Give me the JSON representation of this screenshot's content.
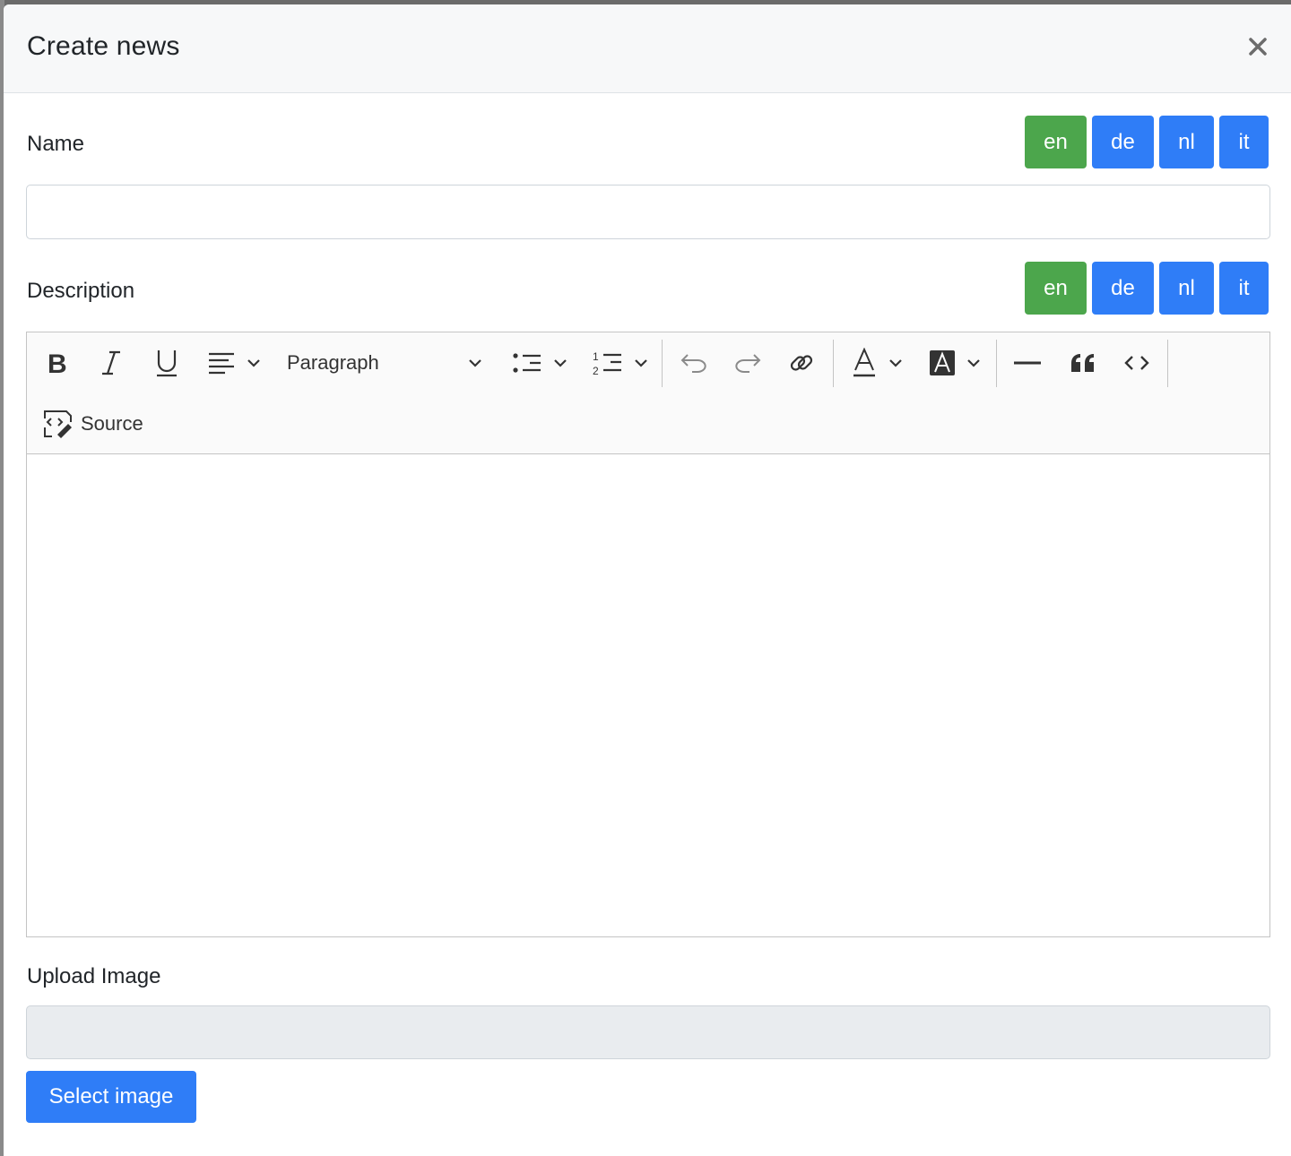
{
  "modal": {
    "title": "Create news",
    "close_icon": "close-icon"
  },
  "name_field": {
    "label": "Name",
    "value": "",
    "placeholder": ""
  },
  "description_field": {
    "label": "Description"
  },
  "languages": {
    "items": [
      {
        "code": "en",
        "active": true
      },
      {
        "code": "de",
        "active": false
      },
      {
        "code": "nl",
        "active": false
      },
      {
        "code": "it",
        "active": false
      }
    ],
    "active_color": "#4ca64c",
    "inactive_color": "#2f7df7"
  },
  "editor": {
    "toolbar": {
      "bold_icon": "bold-icon",
      "italic_icon": "italic-icon",
      "underline_icon": "underline-icon",
      "align_icon": "align-left-icon",
      "heading_select": "Paragraph",
      "bulleted_list_icon": "bulleted-list-icon",
      "numbered_list_icon": "numbered-list-icon",
      "undo_icon": "undo-icon",
      "redo_icon": "redo-icon",
      "link_icon": "link-icon",
      "font_color_icon": "font-color-icon",
      "font_background_icon": "font-background-icon",
      "horizontal_line_icon": "horizontal-line-icon",
      "blockquote_icon": "blockquote-icon",
      "code_icon": "code-icon",
      "source_label": "Source"
    },
    "content": ""
  },
  "upload": {
    "label": "Upload Image",
    "value": "",
    "button_label": "Select image"
  }
}
